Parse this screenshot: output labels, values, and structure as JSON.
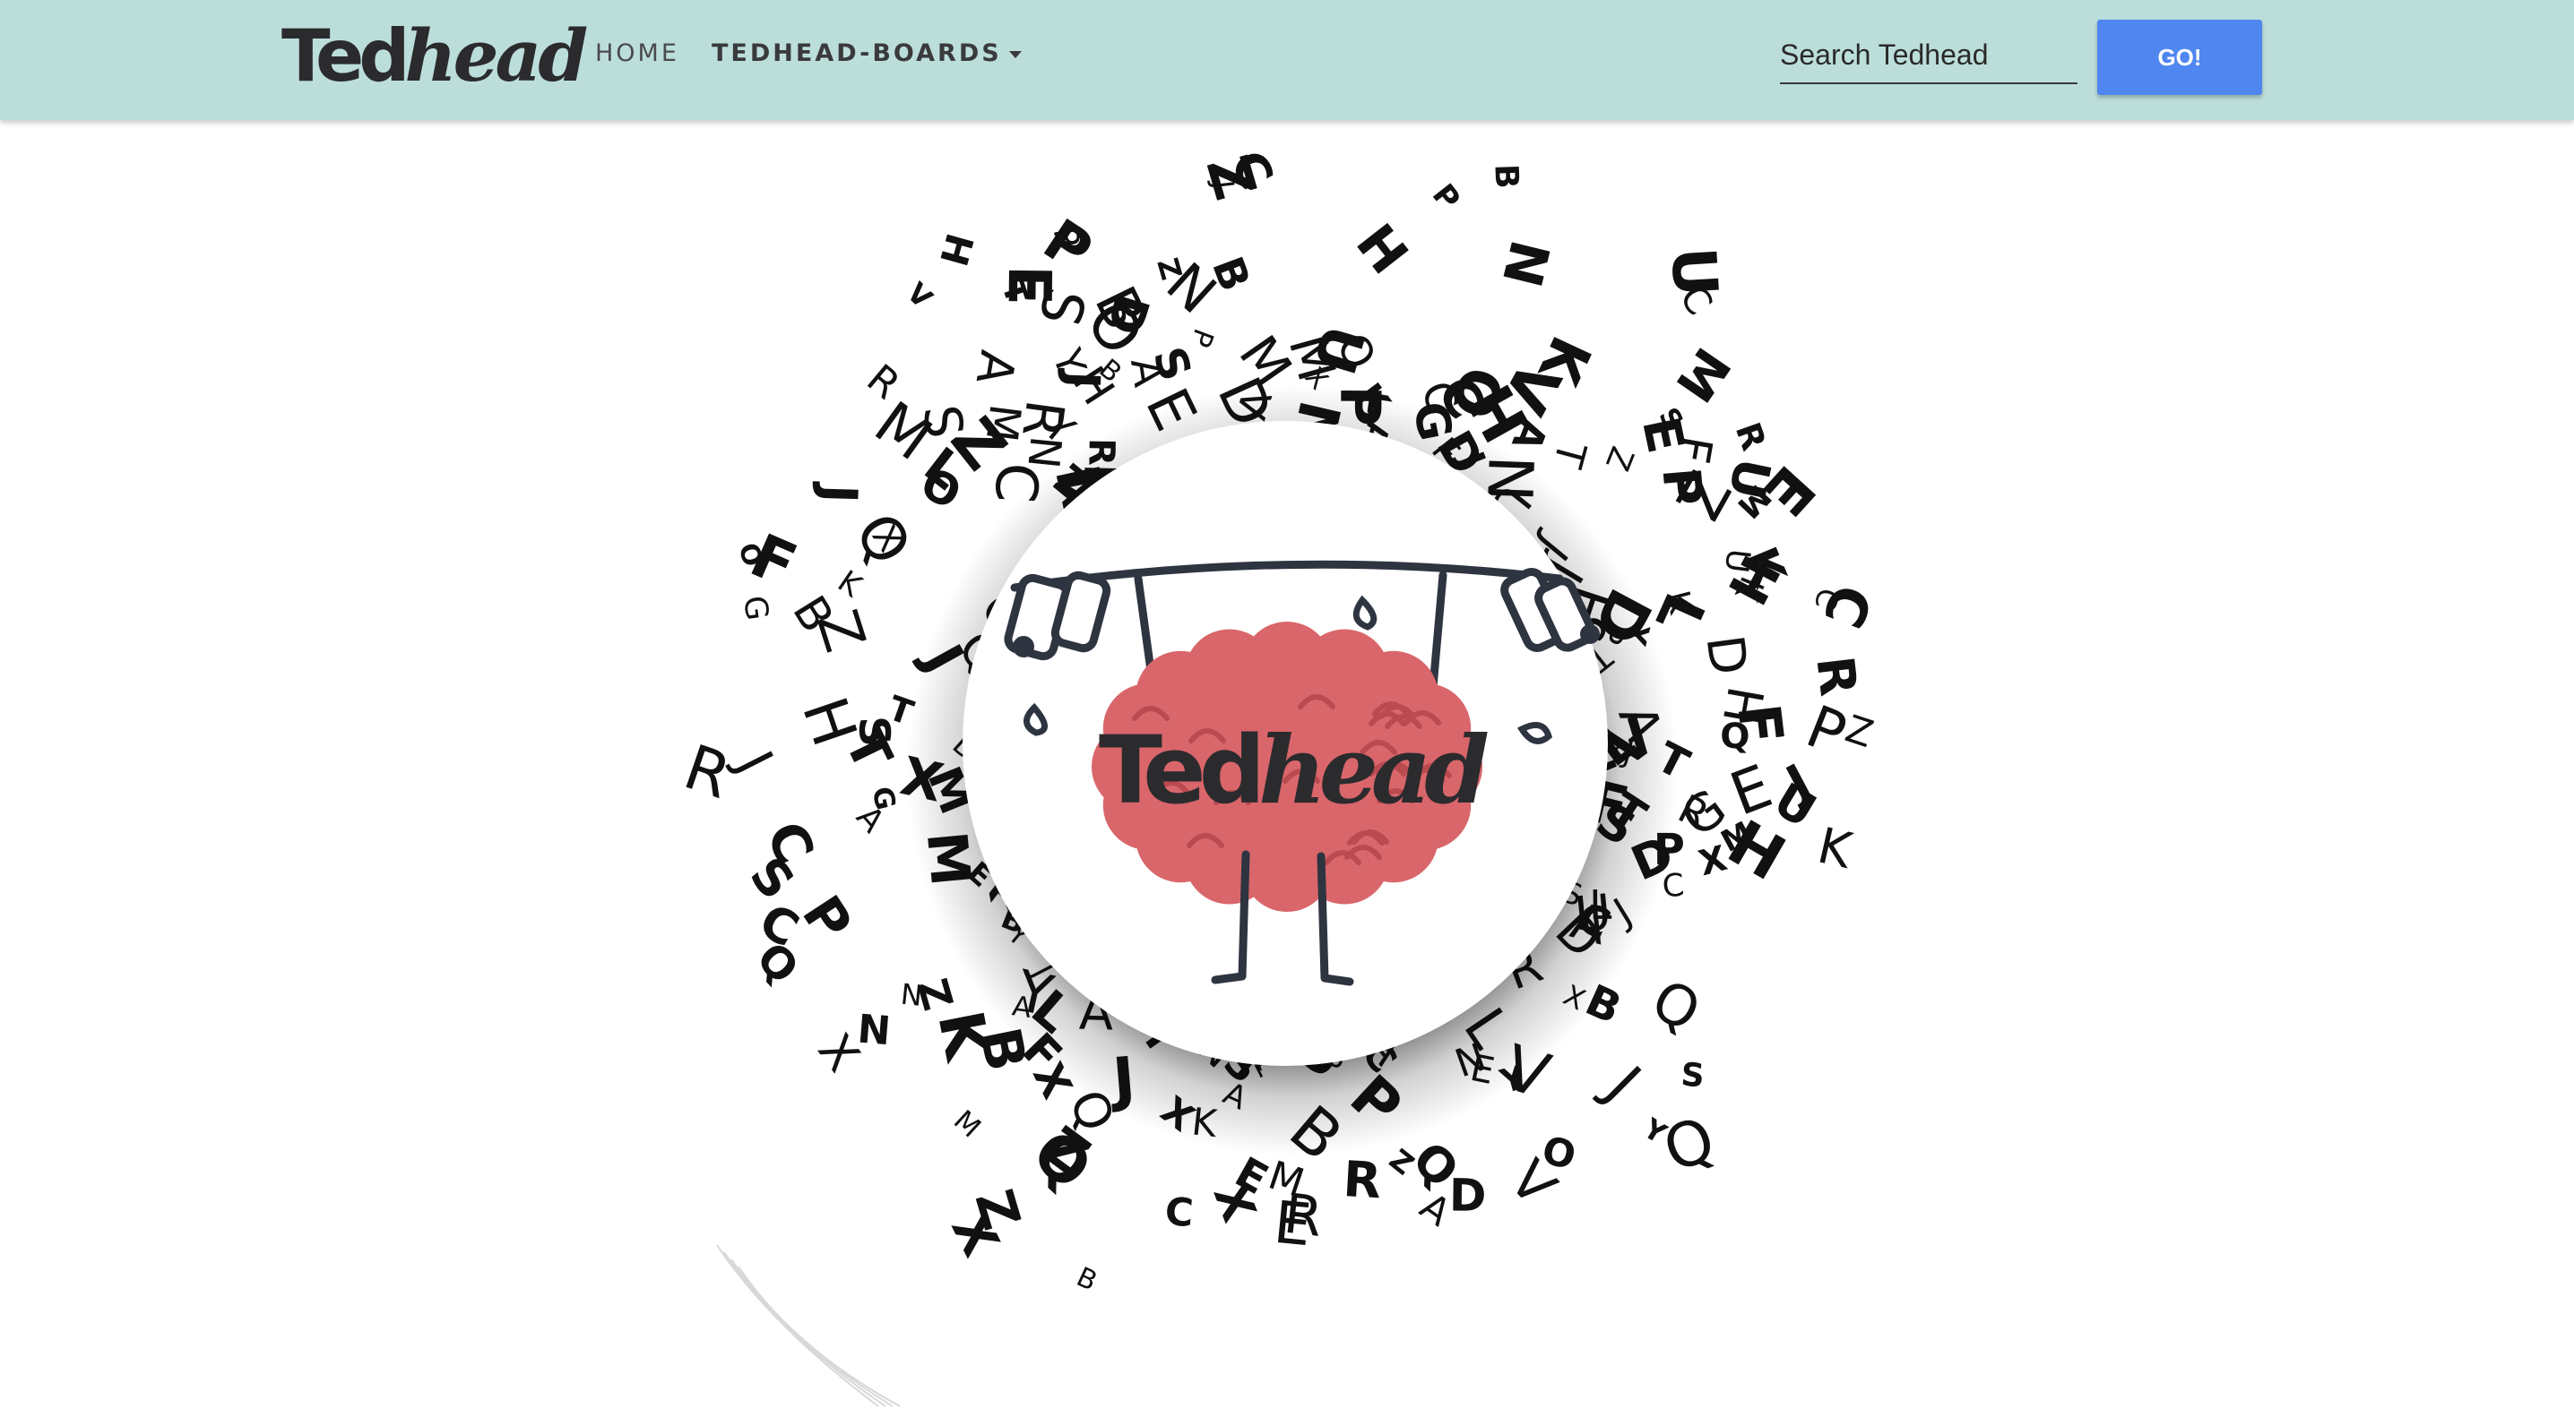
{
  "navbar": {
    "brand_bold": "Ted",
    "brand_light": "head",
    "home_label": "HOME",
    "boards_label": "TEDHEAD-BOARDS",
    "search_placeholder": "Search Tedhead",
    "go_label": "GO!",
    "background_color": "#bcdedb",
    "button_color": "#4f86f0"
  },
  "hero": {
    "logo_bold": "Ted",
    "logo_light": "head",
    "brain_color": "#d9666a",
    "letters": "ZJBZMDYXJTLEQSHMPBZEXQEJVDZPJUEXMHFEKJMAQZMSPBQBRXJFUYTZRZKUCAXCBEKJQHXRJTORQBCASCKNBDAPJAVCMNCKFJGBRZLCYFNAQJCEFPYSRMHXOUNSLNJYNTMACNDSKHGEYEBCRPZADQPVOFMLTDXAZKLCONVXUSPXNOYUSAGHKFRZJCTAEKXCQRSDMFBLEZAVPQYHNDLXPSXCZHUOMSAVDNTBHRGEYSOQPJZ"
  }
}
